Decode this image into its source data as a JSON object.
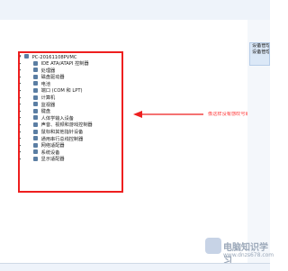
{
  "device_manager": {
    "root": "PC-20161108PVMC",
    "items": [
      "IDE ATA/ATAPI 控制器",
      "处理器",
      "磁盘驱动器",
      "电池",
      "端口 (COM 和 LPT)",
      "计算机",
      "监视器",
      "键盘",
      "人体学输入设备",
      "声音、视频和游戏控制器",
      "鼠标和其他指针设备",
      "通用串行总线控制器",
      "网络适配器",
      "系统设备",
      "显示适配器"
    ]
  },
  "right_panel": {
    "title_lines": [
      "设备管理",
      "设备管理"
    ]
  },
  "annotation": {
    "text": "像这样没有感叹号或者叉号的才是驱动齐全正常的"
  },
  "watermark": {
    "line1": "电脑知识学习",
    "line2": "www.dnzs678.com"
  },
  "colors": {
    "red": "#ee1f1f",
    "text": "#1b1b1b"
  }
}
